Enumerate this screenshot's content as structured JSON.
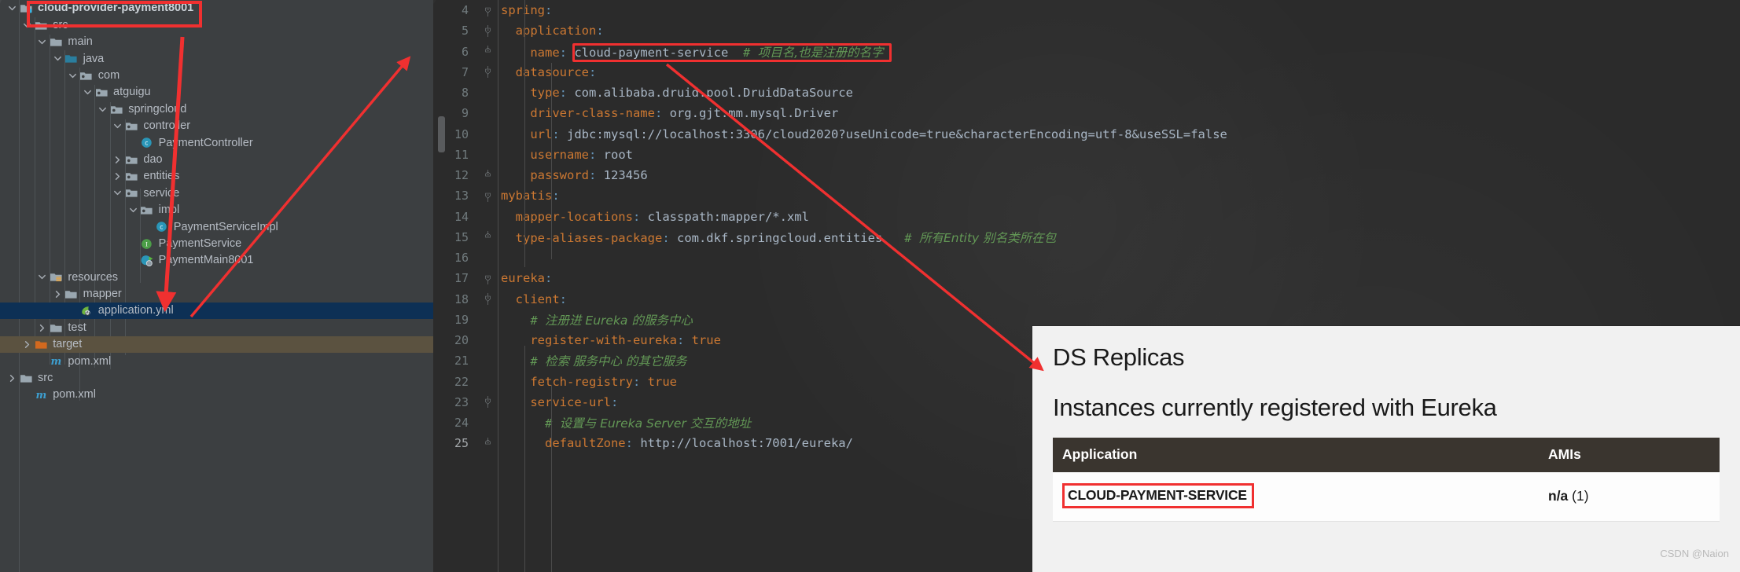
{
  "project_tree": {
    "items": [
      {
        "label": "cloud-provider-payment8001",
        "icon": "module-folder-icon",
        "indent": 1,
        "arrow": "down",
        "bold": true,
        "state": "highlighted"
      },
      {
        "label": "src",
        "icon": "folder-icon",
        "indent": 2,
        "arrow": "down",
        "bold": false,
        "state": "normal"
      },
      {
        "label": "main",
        "icon": "folder-icon",
        "indent": 3,
        "arrow": "down",
        "bold": false,
        "state": "normal"
      },
      {
        "label": "java",
        "icon": "source-folder-icon",
        "indent": 4,
        "arrow": "down",
        "bold": false,
        "state": "normal"
      },
      {
        "label": "com",
        "icon": "package-icon",
        "indent": 5,
        "arrow": "down",
        "bold": false,
        "state": "normal"
      },
      {
        "label": "atguigu",
        "icon": "package-icon",
        "indent": 6,
        "arrow": "down",
        "bold": false,
        "state": "normal"
      },
      {
        "label": "springcloud",
        "icon": "package-icon",
        "indent": 7,
        "arrow": "down",
        "bold": false,
        "state": "normal"
      },
      {
        "label": "controller",
        "icon": "package-icon",
        "indent": 8,
        "arrow": "down",
        "bold": false,
        "state": "normal"
      },
      {
        "label": "PaymentController",
        "icon": "java-class-icon",
        "indent": 9,
        "arrow": "none",
        "bold": false,
        "state": "normal"
      },
      {
        "label": "dao",
        "icon": "package-icon",
        "indent": 8,
        "arrow": "right",
        "bold": false,
        "state": "normal"
      },
      {
        "label": "entities",
        "icon": "package-icon",
        "indent": 8,
        "arrow": "right",
        "bold": false,
        "state": "normal"
      },
      {
        "label": "service",
        "icon": "package-icon",
        "indent": 8,
        "arrow": "down",
        "bold": false,
        "state": "normal"
      },
      {
        "label": "impl",
        "icon": "package-icon",
        "indent": 9,
        "arrow": "down",
        "bold": false,
        "state": "normal"
      },
      {
        "label": "PaymentServiceImpl",
        "icon": "java-class-icon",
        "indent": 10,
        "arrow": "none",
        "bold": false,
        "state": "normal"
      },
      {
        "label": "PaymentService",
        "icon": "java-interface-icon",
        "indent": 9,
        "arrow": "none",
        "bold": false,
        "state": "normal"
      },
      {
        "label": "PaymentMain8001",
        "icon": "spring-boot-main-icon",
        "indent": 9,
        "arrow": "none",
        "bold": false,
        "state": "normal"
      },
      {
        "label": "resources",
        "icon": "resources-folder-icon",
        "indent": 3,
        "arrow": "down",
        "bold": false,
        "state": "normal"
      },
      {
        "label": "mapper",
        "icon": "folder-icon",
        "indent": 4,
        "arrow": "right",
        "bold": false,
        "state": "normal"
      },
      {
        "label": "application.yml",
        "icon": "spring-yaml-icon",
        "indent": 5,
        "arrow": "none",
        "bold": false,
        "state": "selected"
      },
      {
        "label": "test",
        "icon": "folder-icon",
        "indent": 3,
        "arrow": "right",
        "bold": false,
        "state": "normal"
      },
      {
        "label": "target",
        "icon": "target-folder-icon",
        "indent": 2,
        "arrow": "right",
        "bold": false,
        "state": "target"
      },
      {
        "label": "pom.xml",
        "icon": "maven-pom-icon",
        "indent": 3,
        "arrow": "none",
        "bold": false,
        "state": "normal"
      },
      {
        "label": "src",
        "icon": "folder-icon",
        "indent": 1,
        "arrow": "right",
        "bold": false,
        "state": "normal"
      },
      {
        "label": "pom.xml",
        "icon": "maven-pom-icon",
        "indent": 2,
        "arrow": "none",
        "bold": false,
        "state": "normal"
      }
    ]
  },
  "editor": {
    "filename": "application.yml",
    "first_line_number": 4,
    "lines": [
      {
        "n": "4",
        "fold": "collapse-top",
        "tokens": [
          {
            "t": "spring",
            "c": "k"
          },
          {
            "t": ":",
            "c": "p"
          }
        ]
      },
      {
        "n": "5",
        "fold": "collapse-mid",
        "tokens": [
          {
            "t": "  application",
            "c": "k"
          },
          {
            "t": ":",
            "c": "p"
          }
        ]
      },
      {
        "n": "6",
        "fold": "collapse-end",
        "tokens": [
          {
            "t": "    name",
            "c": "k"
          },
          {
            "t": ": ",
            "c": "p"
          },
          {
            "t": "cloud-payment-service",
            "c": "v"
          },
          {
            "t": "  # ",
            "c": "cm"
          },
          {
            "t": "项目名,也是注册的名字",
            "c": "cm cm-han"
          }
        ]
      },
      {
        "n": "7",
        "fold": "collapse-mid",
        "tokens": [
          {
            "t": "  datasource",
            "c": "k"
          },
          {
            "t": ":",
            "c": "p"
          }
        ]
      },
      {
        "n": "8",
        "fold": "none",
        "tokens": [
          {
            "t": "    type",
            "c": "k"
          },
          {
            "t": ": ",
            "c": "p"
          },
          {
            "t": "com.alibaba.druid.pool.DruidDataSource",
            "c": "v"
          }
        ]
      },
      {
        "n": "9",
        "fold": "none",
        "tokens": [
          {
            "t": "    driver-class-name",
            "c": "k"
          },
          {
            "t": ": ",
            "c": "p"
          },
          {
            "t": "org.gjt.mm.mysql.Driver",
            "c": "v"
          }
        ]
      },
      {
        "n": "10",
        "fold": "none",
        "tokens": [
          {
            "t": "    url",
            "c": "k"
          },
          {
            "t": ": ",
            "c": "p"
          },
          {
            "t": "jdbc:mysql://localhost:3306/cloud2020?useUnicode=true&characterEncoding=utf-8&useSSL=false",
            "c": "v"
          }
        ]
      },
      {
        "n": "11",
        "fold": "none",
        "tokens": [
          {
            "t": "    username",
            "c": "k"
          },
          {
            "t": ": ",
            "c": "p"
          },
          {
            "t": "root",
            "c": "v"
          }
        ]
      },
      {
        "n": "12",
        "fold": "collapse-end",
        "tokens": [
          {
            "t": "    password",
            "c": "k"
          },
          {
            "t": ": ",
            "c": "p"
          },
          {
            "t": "123456",
            "c": "v"
          }
        ]
      },
      {
        "n": "13",
        "fold": "collapse-top",
        "tokens": [
          {
            "t": "mybatis",
            "c": "k"
          },
          {
            "t": ":",
            "c": "p"
          }
        ]
      },
      {
        "n": "14",
        "fold": "none",
        "tokens": [
          {
            "t": "  mapper-locations",
            "c": "k"
          },
          {
            "t": ": ",
            "c": "p"
          },
          {
            "t": "classpath:mapper/*.xml",
            "c": "v"
          }
        ]
      },
      {
        "n": "15",
        "fold": "collapse-end",
        "tokens": [
          {
            "t": "  type-aliases-package",
            "c": "k"
          },
          {
            "t": ": ",
            "c": "p"
          },
          {
            "t": "com.dkf.springcloud.entities",
            "c": "v"
          },
          {
            "t": "   # ",
            "c": "cm"
          },
          {
            "t": "所有Entity 别名类所在包",
            "c": "cm cm-han"
          }
        ]
      },
      {
        "n": "16",
        "fold": "none",
        "tokens": []
      },
      {
        "n": "17",
        "fold": "collapse-top",
        "tokens": [
          {
            "t": "eureka",
            "c": "k"
          },
          {
            "t": ":",
            "c": "p"
          }
        ]
      },
      {
        "n": "18",
        "fold": "collapse-mid",
        "tokens": [
          {
            "t": "  client",
            "c": "k"
          },
          {
            "t": ":",
            "c": "p"
          }
        ]
      },
      {
        "n": "19",
        "fold": "none",
        "tokens": [
          {
            "t": "    # ",
            "c": "cm"
          },
          {
            "t": "注册进 Eureka 的服务中心",
            "c": "cm cm-han"
          }
        ]
      },
      {
        "n": "20",
        "fold": "none",
        "tokens": [
          {
            "t": "    register-with-eureka",
            "c": "k"
          },
          {
            "t": ": ",
            "c": "p"
          },
          {
            "t": "true",
            "c": "k"
          }
        ]
      },
      {
        "n": "21",
        "fold": "none",
        "tokens": [
          {
            "t": "    # ",
            "c": "cm"
          },
          {
            "t": "检索 服务中心 的其它服务",
            "c": "cm cm-han"
          }
        ]
      },
      {
        "n": "22",
        "fold": "none",
        "tokens": [
          {
            "t": "    fetch-registry",
            "c": "k"
          },
          {
            "t": ": ",
            "c": "p"
          },
          {
            "t": "true",
            "c": "k"
          }
        ]
      },
      {
        "n": "23",
        "fold": "collapse-mid",
        "tokens": [
          {
            "t": "    service-url",
            "c": "k"
          },
          {
            "t": ":",
            "c": "p"
          }
        ]
      },
      {
        "n": "24",
        "fold": "none",
        "tokens": [
          {
            "t": "      # ",
            "c": "cm"
          },
          {
            "t": "设置与 Eureka Server 交互的地址",
            "c": "cm cm-han"
          }
        ]
      },
      {
        "n": "25",
        "fold": "collapse-end",
        "tokens": [
          {
            "t": "      defaultZone",
            "c": "k"
          },
          {
            "t": ": ",
            "c": "p"
          },
          {
            "t": "http://localhost:7001/eureka/",
            "c": "v"
          }
        ]
      }
    ]
  },
  "eureka_panel": {
    "ds_replicas_title": "DS Replicas",
    "instances_title": "Instances currently registered with Eureka",
    "table": {
      "headers": [
        "Application",
        "AMIs"
      ],
      "rows": [
        {
          "application": "CLOUD-PAYMENT-SERVICE",
          "ami_value": "n/a",
          "ami_count": "(1)"
        }
      ]
    },
    "watermark": "CSDN @Naion"
  },
  "annotations": {
    "accent_color": "#f03030",
    "arrows": [
      {
        "name": "arrow-module-to-name",
        "from": "cloud-provider-payment8001 tree node",
        "to": "spring.application.name key"
      },
      {
        "name": "arrow-name-value-to-eureka-row",
        "from": "cloud-payment-service value",
        "to": "CLOUD-PAYMENT-SERVICE table row"
      },
      {
        "name": "arrow-application-yml",
        "from": "editor",
        "to": "application.yml tree node"
      }
    ],
    "boxes": [
      {
        "name": "box-module-node",
        "target": "cloud-provider-payment8001"
      },
      {
        "name": "box-name-value",
        "target": "name: cloud-payment-service # 项目名,也是注册的名字"
      },
      {
        "name": "box-eureka-app-name",
        "target": "CLOUD-PAYMENT-SERVICE"
      }
    ]
  }
}
